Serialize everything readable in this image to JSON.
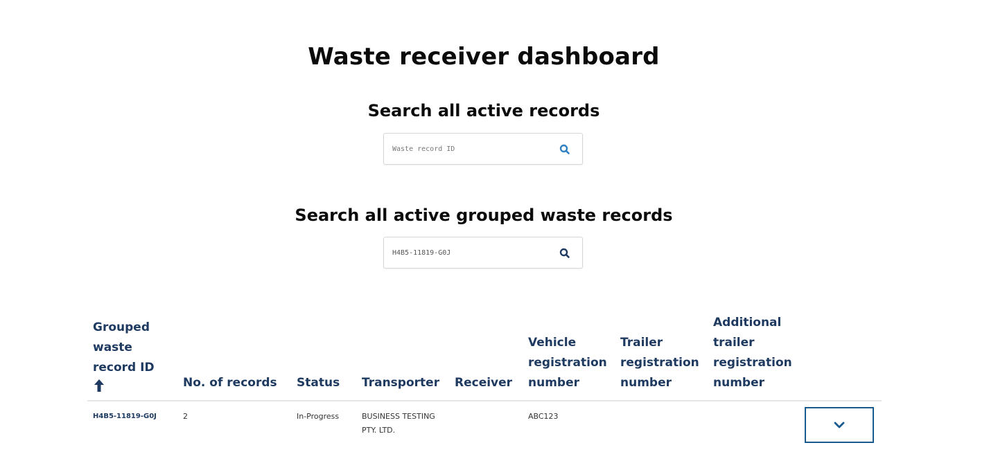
{
  "page": {
    "title": "Waste receiver dashboard"
  },
  "search_records": {
    "title": "Search all active records",
    "placeholder": "Waste record ID",
    "value": "",
    "icon": "search-icon"
  },
  "search_grouped": {
    "title": "Search all active grouped waste records",
    "placeholder": "",
    "value": "H4B5-11819-G0J",
    "icon": "search-icon"
  },
  "table": {
    "headers": {
      "grouped_id": "Grouped waste record ID",
      "num_records": "No. of records",
      "status": "Status",
      "transporter": "Transporter",
      "receiver": "Receiver",
      "vehicle_reg": "Vehicle registration number",
      "trailer_reg": "Trailer registration number",
      "additional_trailer_reg": "Additional trailer registration number"
    },
    "sort": {
      "column": "grouped_id",
      "direction": "ascending",
      "icon": "arrow-up-icon"
    },
    "rows": [
      {
        "grouped_id": "H4B5-11819-G0J",
        "num_records": "2",
        "status": "In-Progress",
        "transporter": "BUSINESS TESTING PTY. LTD.",
        "receiver": "",
        "vehicle_reg": "ABC123",
        "trailer_reg": "",
        "additional_trailer_reg": "",
        "expand_icon": "chevron-down-icon"
      }
    ]
  },
  "colors": {
    "header_text": "#1f3a60",
    "accent": "#1a5b8f",
    "search_icon": "#2f7fc1"
  }
}
